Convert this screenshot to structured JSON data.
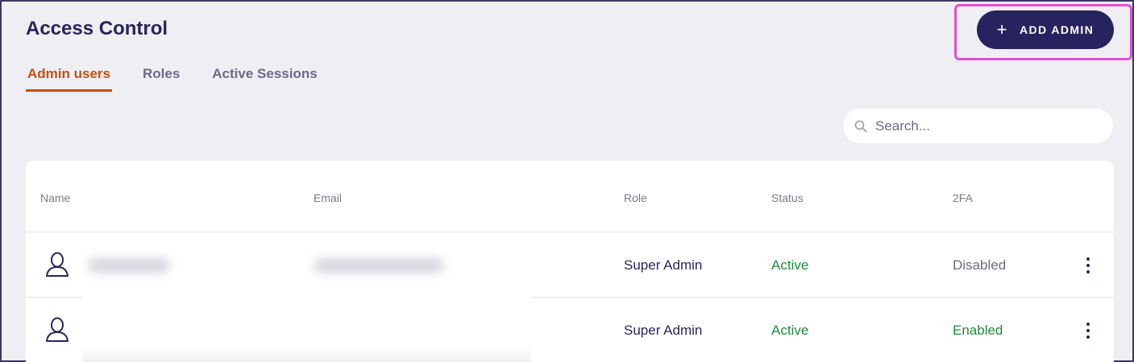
{
  "header": {
    "title": "Access Control",
    "add_admin_label": "ADD ADMIN",
    "add_admin_icon": "plus-icon"
  },
  "tabs": [
    {
      "label": "Admin users",
      "active": true
    },
    {
      "label": "Roles",
      "active": false
    },
    {
      "label": "Active Sessions",
      "active": false
    }
  ],
  "search": {
    "placeholder": "Search...",
    "value": "",
    "icon": "search-icon"
  },
  "table": {
    "columns": [
      "Name",
      "Email",
      "Role",
      "Status",
      "2FA"
    ],
    "rows": [
      {
        "role": "Super Admin",
        "status": "Active",
        "twofa": "Disabled"
      },
      {
        "role": "Super Admin",
        "status": "Active",
        "twofa": "Enabled"
      }
    ]
  },
  "colors": {
    "primary": "#27235f",
    "accent_tab": "#c5500f",
    "active_status": "#1f8a3b",
    "highlight": "#e54ed2"
  }
}
